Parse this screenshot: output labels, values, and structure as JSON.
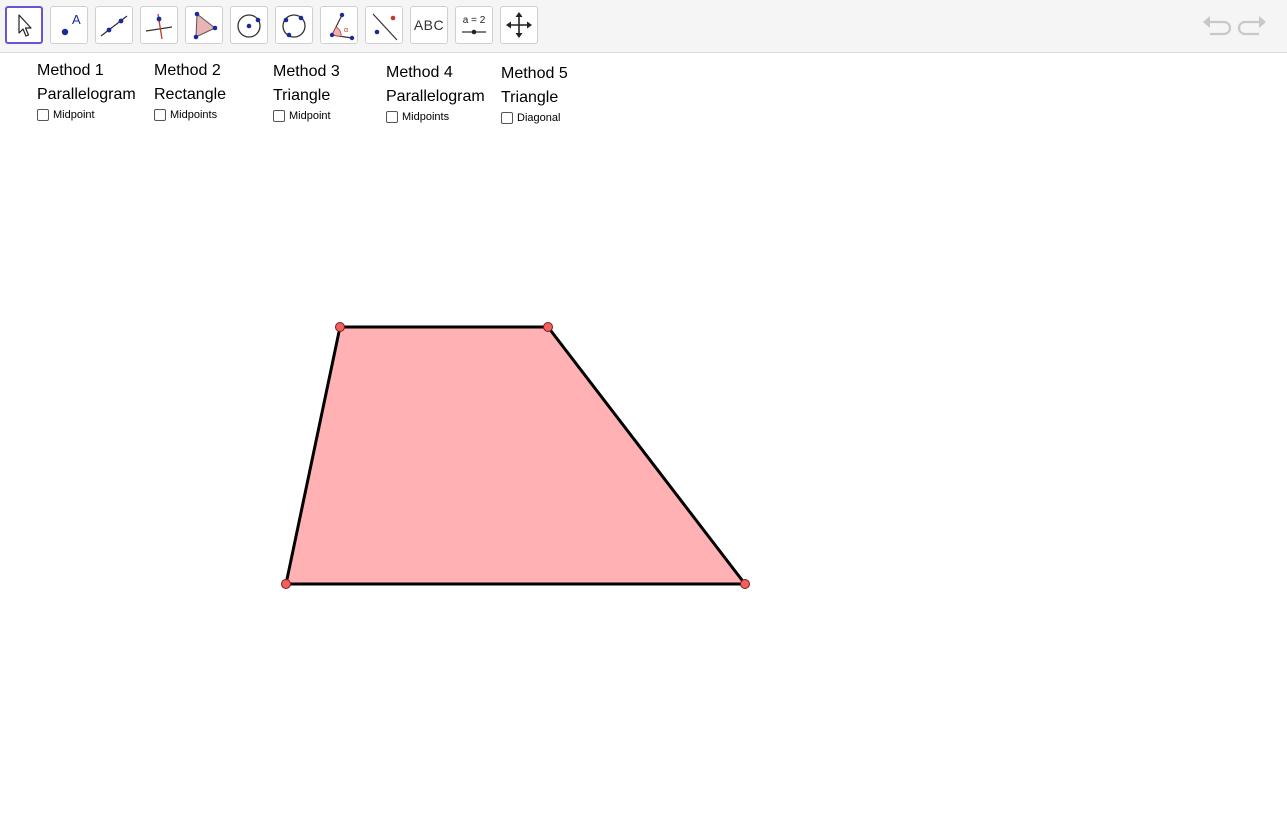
{
  "toolbar": {
    "tools": [
      {
        "name": "move-tool",
        "icon": "arrow-cursor-icon",
        "active": true
      },
      {
        "name": "point-tool",
        "icon": "point-icon",
        "label": "A"
      },
      {
        "name": "line-tool",
        "icon": "line-through-points-icon"
      },
      {
        "name": "perpendicular-line-tool",
        "icon": "perpendicular-line-icon"
      },
      {
        "name": "polygon-tool",
        "icon": "polygon-icon"
      },
      {
        "name": "circle-tool",
        "icon": "circle-center-point-icon"
      },
      {
        "name": "circle-three-points-tool",
        "icon": "circle-three-points-icon"
      },
      {
        "name": "angle-tool",
        "icon": "angle-icon"
      },
      {
        "name": "reflect-tool",
        "icon": "reflect-about-line-icon"
      },
      {
        "name": "text-tool",
        "icon": "text-icon",
        "label": "ABC"
      },
      {
        "name": "slider-tool",
        "icon": "slider-icon",
        "label": "a = 2"
      },
      {
        "name": "move-graphics-view-tool",
        "icon": "move-graphics-view-icon"
      }
    ],
    "undo_icon": "undo-icon",
    "redo_icon": "redo-icon"
  },
  "methods": [
    {
      "title": "Method 1",
      "shape": "Parallelogram",
      "checkbox_label": "Midpoint",
      "checked": false
    },
    {
      "title": "Method 2",
      "shape": "Rectangle",
      "checkbox_label": "Midpoints",
      "checked": false
    },
    {
      "title": "Method 3",
      "shape": "Triangle",
      "checkbox_label": "Midpoint",
      "checked": false
    },
    {
      "title": "Method 4",
      "shape": "Parallelogram",
      "checkbox_label": "Midpoints",
      "checked": false
    },
    {
      "title": "Method 5",
      "shape": "Triangle",
      "checkbox_label": "Diagonal",
      "checked": false
    }
  ],
  "figure": {
    "shape": "trapezoid",
    "fill_color": "#ffb1b3",
    "edge_color": "#000000",
    "vertex_color": "#f25f5c"
  }
}
